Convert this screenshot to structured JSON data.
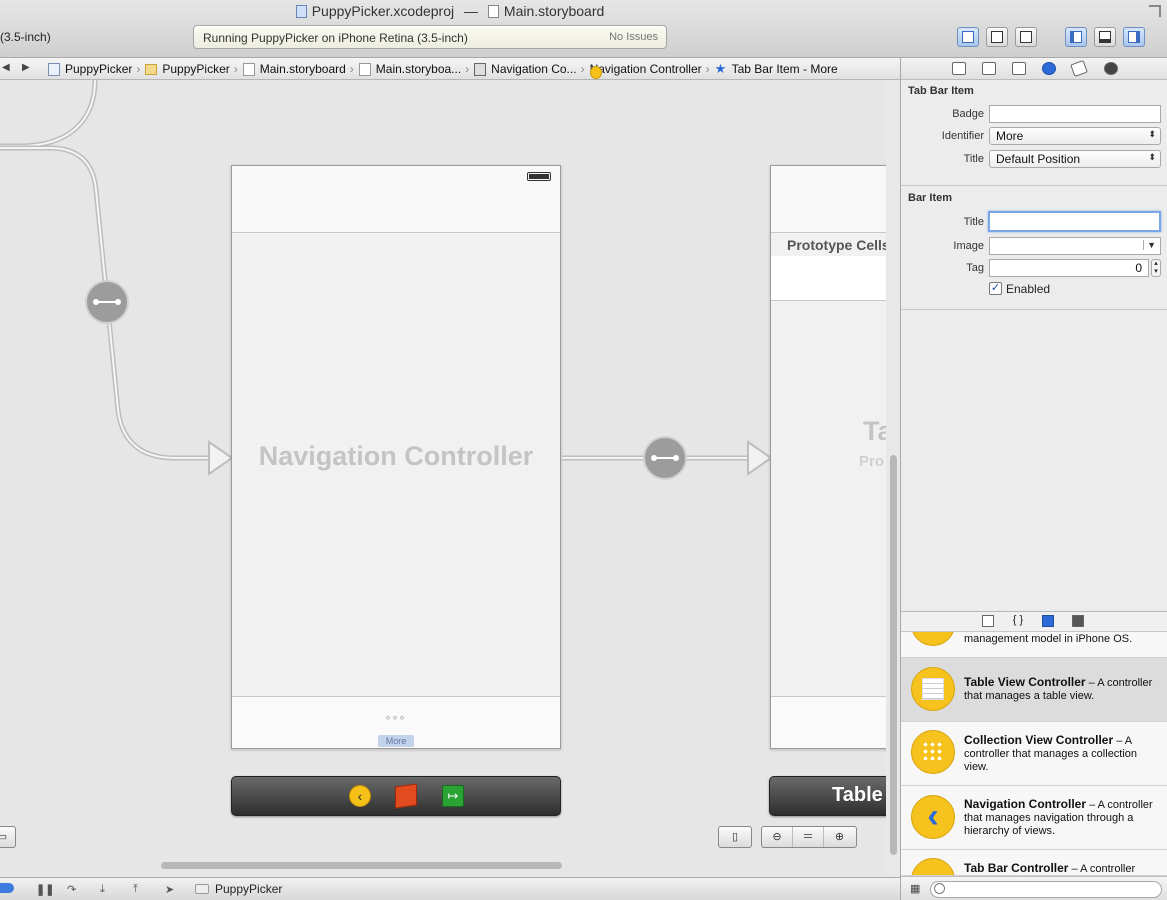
{
  "window": {
    "project_file": "PuppyPicker.xcodeproj",
    "separator": "—",
    "document": "Main.storyboard",
    "scheme_partial": "(3.5-inch)"
  },
  "activity": {
    "message": "Running PuppyPicker on iPhone Retina (3.5-inch)",
    "issues": "No Issues"
  },
  "jumpbar": {
    "crumbs": [
      {
        "label": "PuppyPicker",
        "icon": "project-icon"
      },
      {
        "label": "PuppyPicker",
        "icon": "folder-icon"
      },
      {
        "label": "Main.storyboard",
        "icon": "storyboard-icon"
      },
      {
        "label": "Main.storyboa...",
        "icon": "storyboard-icon"
      },
      {
        "label": "Navigation Co...",
        "icon": "scene-icon"
      },
      {
        "label": "Navigation Controller",
        "icon": "navigation-controller-icon"
      },
      {
        "label": "Tab Bar Item - More",
        "icon": "star-icon"
      }
    ]
  },
  "canvas": {
    "nav_scene_title": "Navigation Controller",
    "more_dots": "◦◦◦",
    "more_label": "More",
    "table_scene_header": "Prototype Cells",
    "table_scene_title_partial": "Ta",
    "table_scene_sub_partial": "Pro",
    "table_dock_label": "Table"
  },
  "inspector": {
    "tab_bar_item": {
      "title": "Tab Bar Item",
      "badge_label": "Badge",
      "badge_value": "",
      "identifier_label": "Identifier",
      "identifier_value": "More",
      "title_label": "Title",
      "title_value": "Default Position"
    },
    "bar_item": {
      "title": "Bar Item",
      "title_label": "Title",
      "title_value": "",
      "image_label": "Image",
      "image_value": "",
      "tag_label": "Tag",
      "tag_value": "0",
      "enabled_label": "Enabled",
      "enabled": true
    }
  },
  "library": {
    "items": [
      {
        "desc": "management model in iPhone OS."
      },
      {
        "name": "Table View Controller",
        "desc": " – A controller that manages a table view."
      },
      {
        "name": "Collection View Controller",
        "desc": " – A controller that manages a collection view."
      },
      {
        "name": "Navigation Controller",
        "desc": " – A controller that manages navigation through a hierarchy of views."
      },
      {
        "name": "Tab Bar Controller",
        "desc": " – A controller"
      }
    ]
  },
  "debug": {
    "target": "PuppyPicker"
  }
}
